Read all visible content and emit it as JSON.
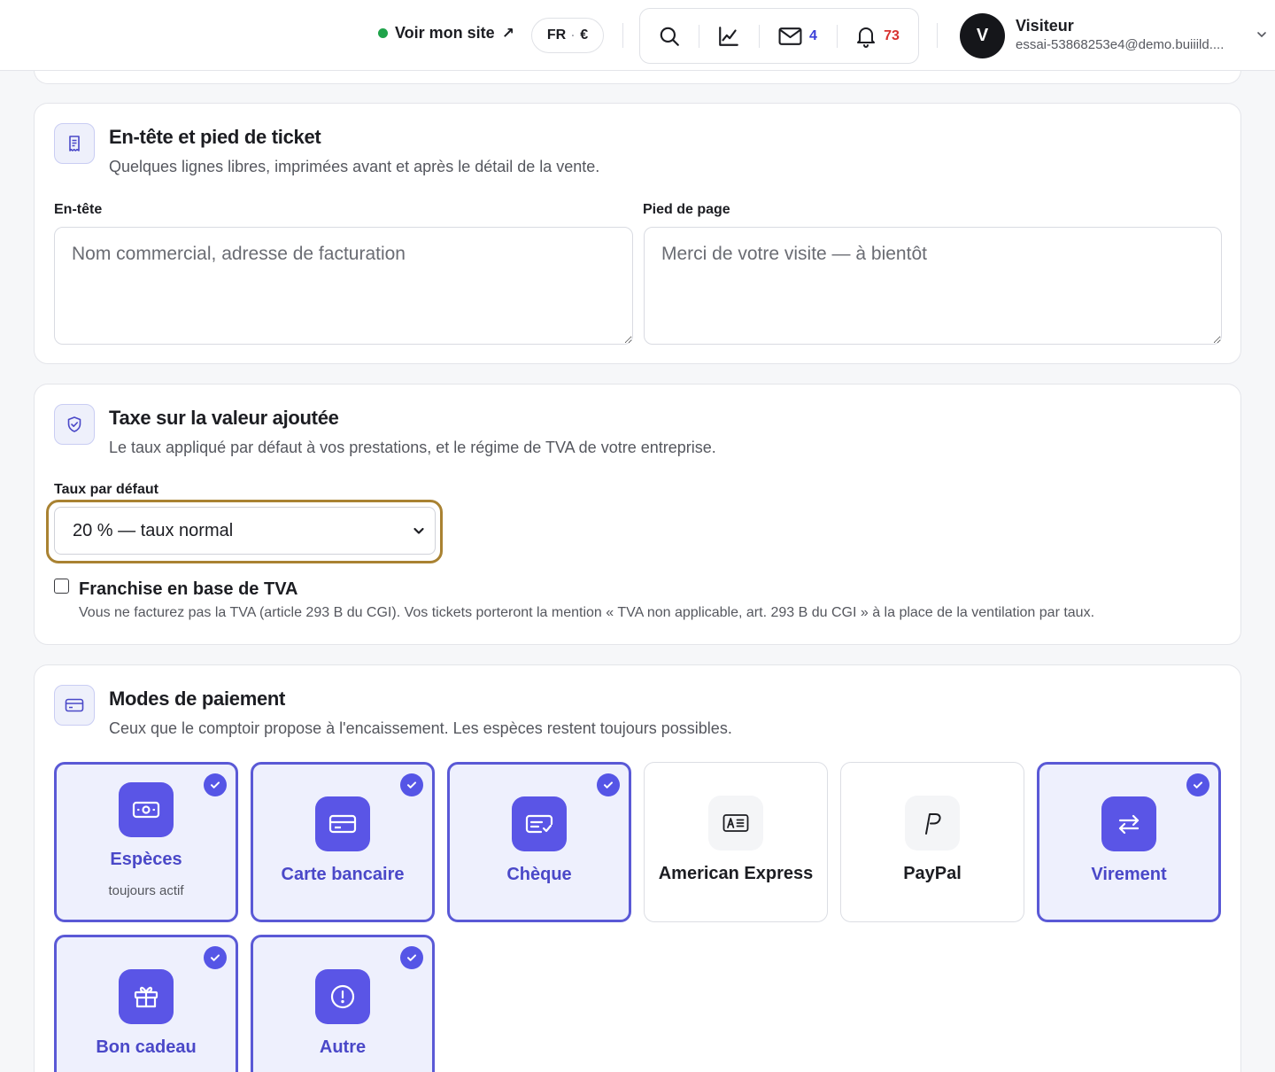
{
  "topbar": {
    "site_link": "Voir mon site",
    "site_arrow": "↗",
    "locale": "FR",
    "locale_sep": "·",
    "currency": "€",
    "messages_count": "4",
    "notifications_count": "73",
    "user_initial": "V",
    "user_name": "Visiteur",
    "user_email": "essai-53868253e4@demo.buiiild...."
  },
  "ticket": {
    "title": "En-tête et pied de ticket",
    "subtitle": "Quelques lignes libres, imprimées avant et après le détail de la vente.",
    "header_label": "En-tête",
    "header_placeholder": "Nom commercial, adresse de facturation",
    "footer_label": "Pied de page",
    "footer_placeholder": "Merci de votre visite — à bientôt"
  },
  "vat": {
    "title": "Taxe sur la valeur ajoutée",
    "subtitle": "Le taux appliqué par défaut à vos prestations, et le régime de TVA de votre entreprise.",
    "rate_label": "Taux par défaut",
    "rate_value": "20 % — taux normal",
    "franchise_label": "Franchise en base de TVA",
    "franchise_checked": false,
    "franchise_help": "Vous ne facturez pas la TVA (article 293 B du CGI). Vos tickets porteront la mention « TVA non applicable, art. 293 B du CGI » à la place de la ventilation par taux."
  },
  "payment": {
    "title": "Modes de paiement",
    "subtitle": "Ceux que le comptoir propose à l'encaissement. Les espèces restent toujours possibles.",
    "methods": [
      {
        "label": "Espèces",
        "note": "toujours actif",
        "enabled": true,
        "icon": "cash-icon"
      },
      {
        "label": "Carte bancaire",
        "enabled": true,
        "icon": "credit-card-icon"
      },
      {
        "label": "Chèque",
        "enabled": true,
        "icon": "cheque-icon"
      },
      {
        "label": "American Express",
        "enabled": false,
        "icon": "amex-icon"
      },
      {
        "label": "PayPal",
        "enabled": false,
        "icon": "paypal-icon"
      },
      {
        "label": "Virement",
        "enabled": true,
        "icon": "transfer-icon"
      },
      {
        "label": "Bon cadeau",
        "enabled": true,
        "icon": "gift-icon"
      },
      {
        "label": "Autre",
        "enabled": true,
        "icon": "alert-circle-icon"
      }
    ]
  },
  "colors": {
    "accent": "#5a55e6",
    "accent_text": "#4a48c8",
    "focus_ring": "#a98232",
    "online": "#1fa34a",
    "notification": "#d8322f",
    "messages": "#3b3fd8"
  }
}
